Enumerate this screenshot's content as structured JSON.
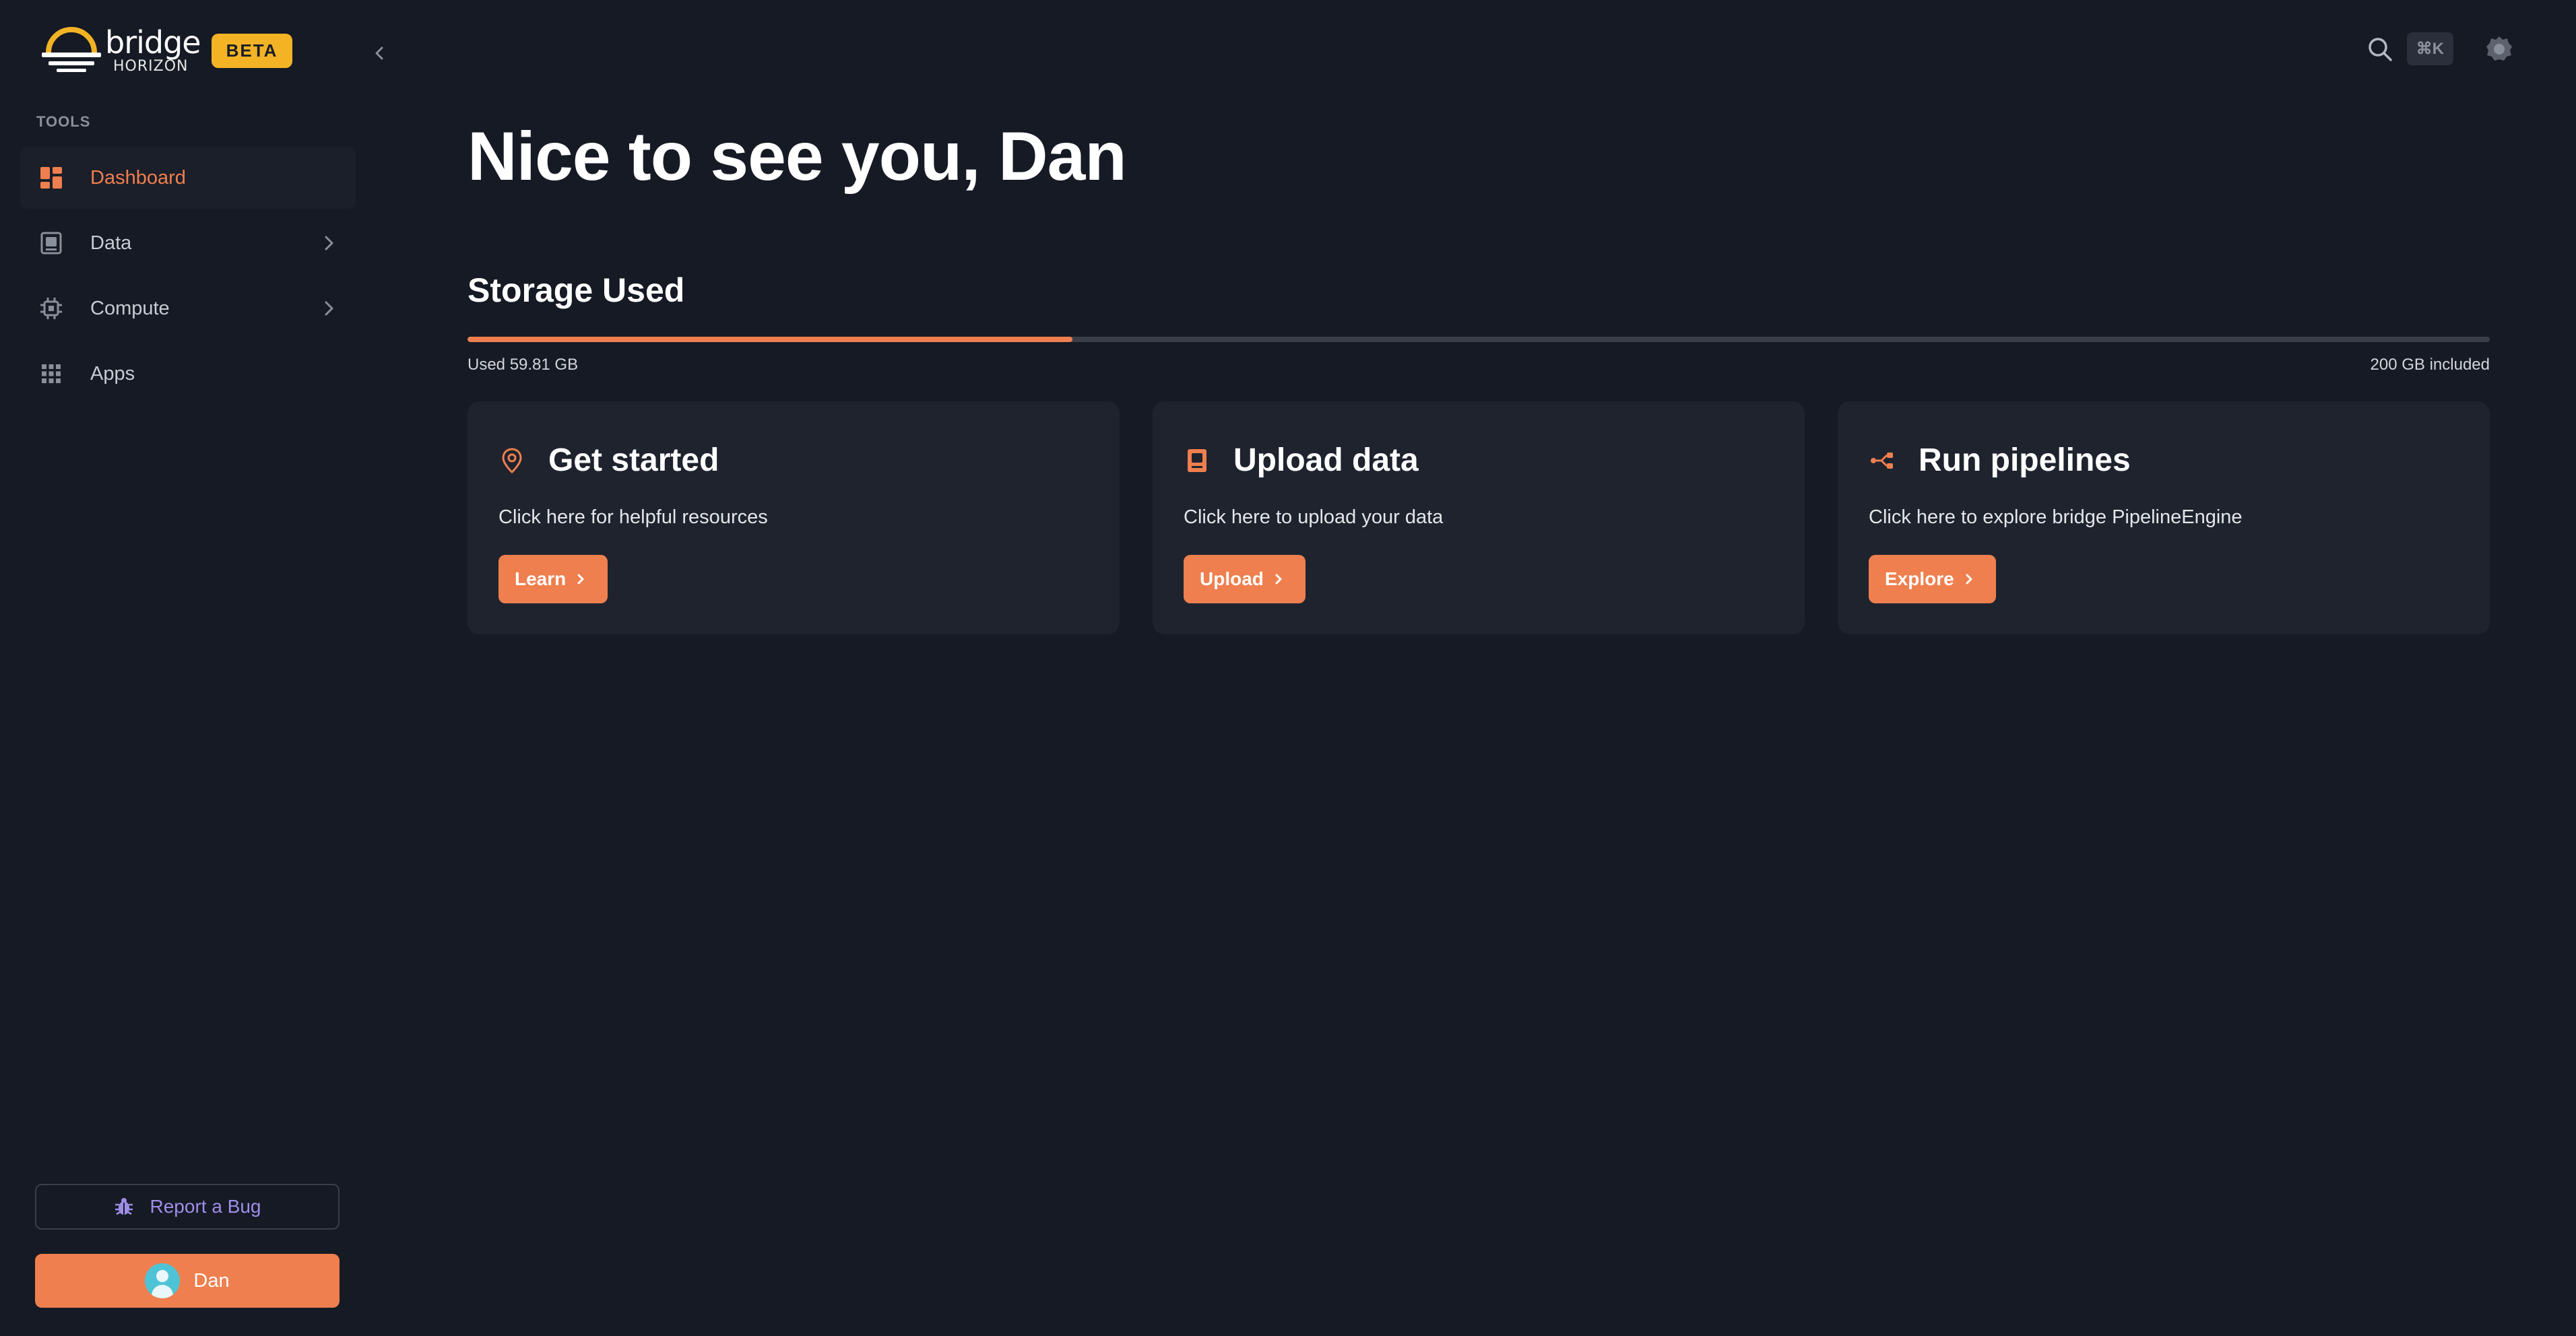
{
  "brand": {
    "name": "bridge",
    "sub": "HORIZON",
    "badge": "BETA",
    "accent_color": "#ef7f4e",
    "badge_color": "#f3b325"
  },
  "sidebar": {
    "section_label": "TOOLS",
    "items": [
      {
        "label": "Dashboard",
        "icon": "dashboard-icon",
        "active": true
      },
      {
        "label": "Data",
        "icon": "data-icon",
        "has_submenu": true
      },
      {
        "label": "Compute",
        "icon": "compute-icon",
        "has_submenu": true
      },
      {
        "label": "Apps",
        "icon": "apps-grid-icon"
      }
    ],
    "report_bug_label": "Report a Bug",
    "user_name": "Dan"
  },
  "header": {
    "shortcut": "⌘K",
    "icons": [
      "search-icon",
      "settings-icon"
    ]
  },
  "main": {
    "greeting": "Nice to see you, Dan",
    "storage": {
      "title": "Storage Used",
      "used_label": "Used 59.81 GB",
      "total_label": "200 GB included",
      "used_fraction": 0.299
    },
    "cards": [
      {
        "title": "Get started",
        "desc": "Click here for helpful resources",
        "button": "Learn",
        "icon": "location-pin-icon"
      },
      {
        "title": "Upload data",
        "desc": "Click here to upload your data",
        "button": "Upload",
        "icon": "upload-data-icon"
      },
      {
        "title": "Run pipelines",
        "desc": "Click here to explore bridge PipelineEngine",
        "button": "Explore",
        "icon": "pipeline-icon"
      }
    ]
  }
}
